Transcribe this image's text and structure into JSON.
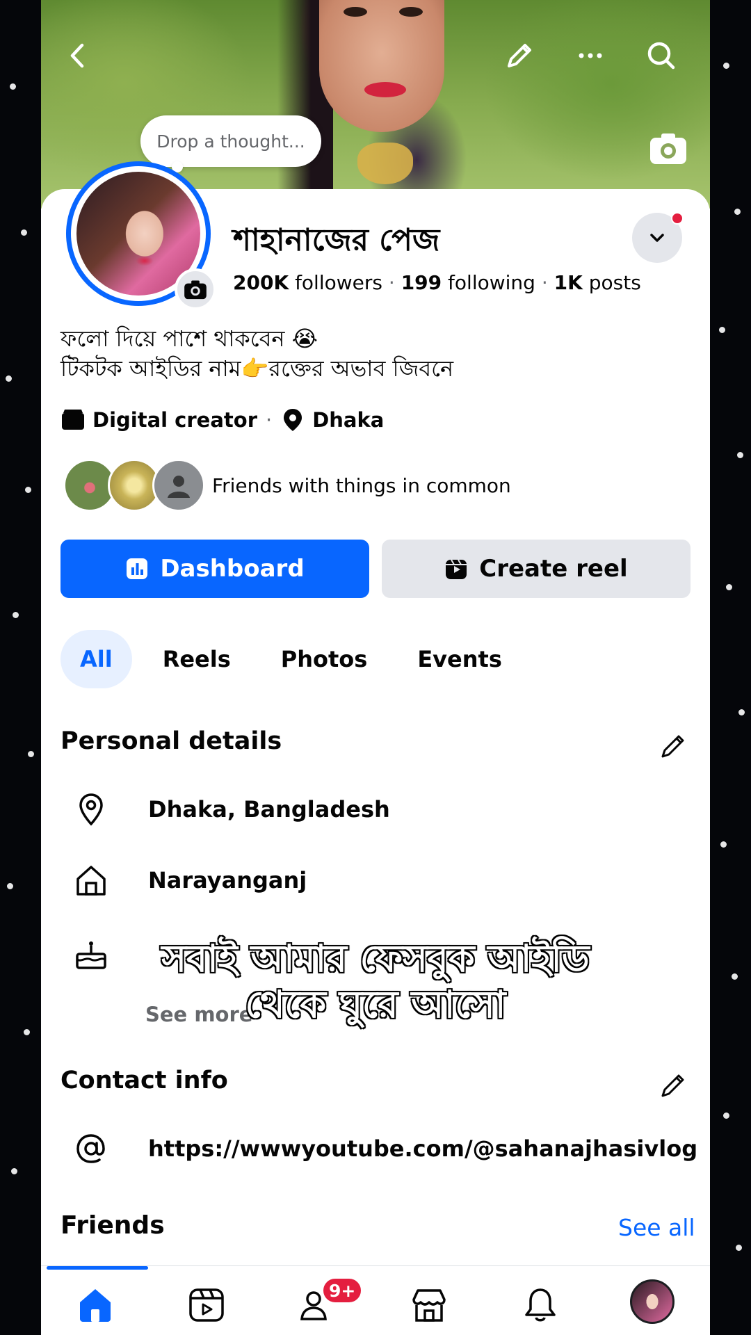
{
  "cover": {
    "thought_bubble": "Drop a thought...",
    "top_icons": [
      "back-arrow-icon",
      "pencil-icon",
      "more-icon",
      "search-icon"
    ],
    "camera_icon": "camera-icon"
  },
  "profile": {
    "name": "শাহানাজের পেজ",
    "followers_count": "200K",
    "followers_label": "followers",
    "following_count": "199",
    "following_label": "following",
    "posts_count": "1K",
    "posts_label": "posts",
    "bio": "ফলো দিয়ে পাশে থাকবেন 😭\nটিকটক আইডির নাম👉রক্তের অভাব জিবনে",
    "category": "Digital creator",
    "location": "Dhaka",
    "friends_common": "Friends with things in common"
  },
  "actions": {
    "dashboard": "Dashboard",
    "create_reel": "Create reel"
  },
  "tabs": [
    {
      "label": "All",
      "active": true
    },
    {
      "label": "Reels",
      "active": false
    },
    {
      "label": "Photos",
      "active": false
    },
    {
      "label": "Events",
      "active": false
    }
  ],
  "personal_details": {
    "title": "Personal details",
    "items": [
      {
        "icon": "location-pin-icon",
        "text": "Dhaka, Bangladesh"
      },
      {
        "icon": "home-icon",
        "text": "Narayanganj"
      },
      {
        "icon": "birthday-cake-icon",
        "text": ""
      }
    ],
    "see_more": "See more"
  },
  "contact_info": {
    "title": "Contact info",
    "link": "https://wwwyoutube.com/@sahanajhasivlog"
  },
  "friends": {
    "title": "Friends",
    "see_all": "See all"
  },
  "bottom_nav": {
    "items": [
      "home-icon",
      "video-icon",
      "friends-icon",
      "marketplace-icon",
      "notifications-icon",
      "profile-avatar"
    ],
    "friends_badge": "9+"
  },
  "overlay_caption": {
    "line1": "সবাই আমার ফেসবুক আইডি",
    "line2": "থেকে ঘুরে আসো"
  },
  "colors": {
    "accent": "#0866ff",
    "badge": "#e41e3f",
    "secondary_button": "#e4e6eb"
  }
}
